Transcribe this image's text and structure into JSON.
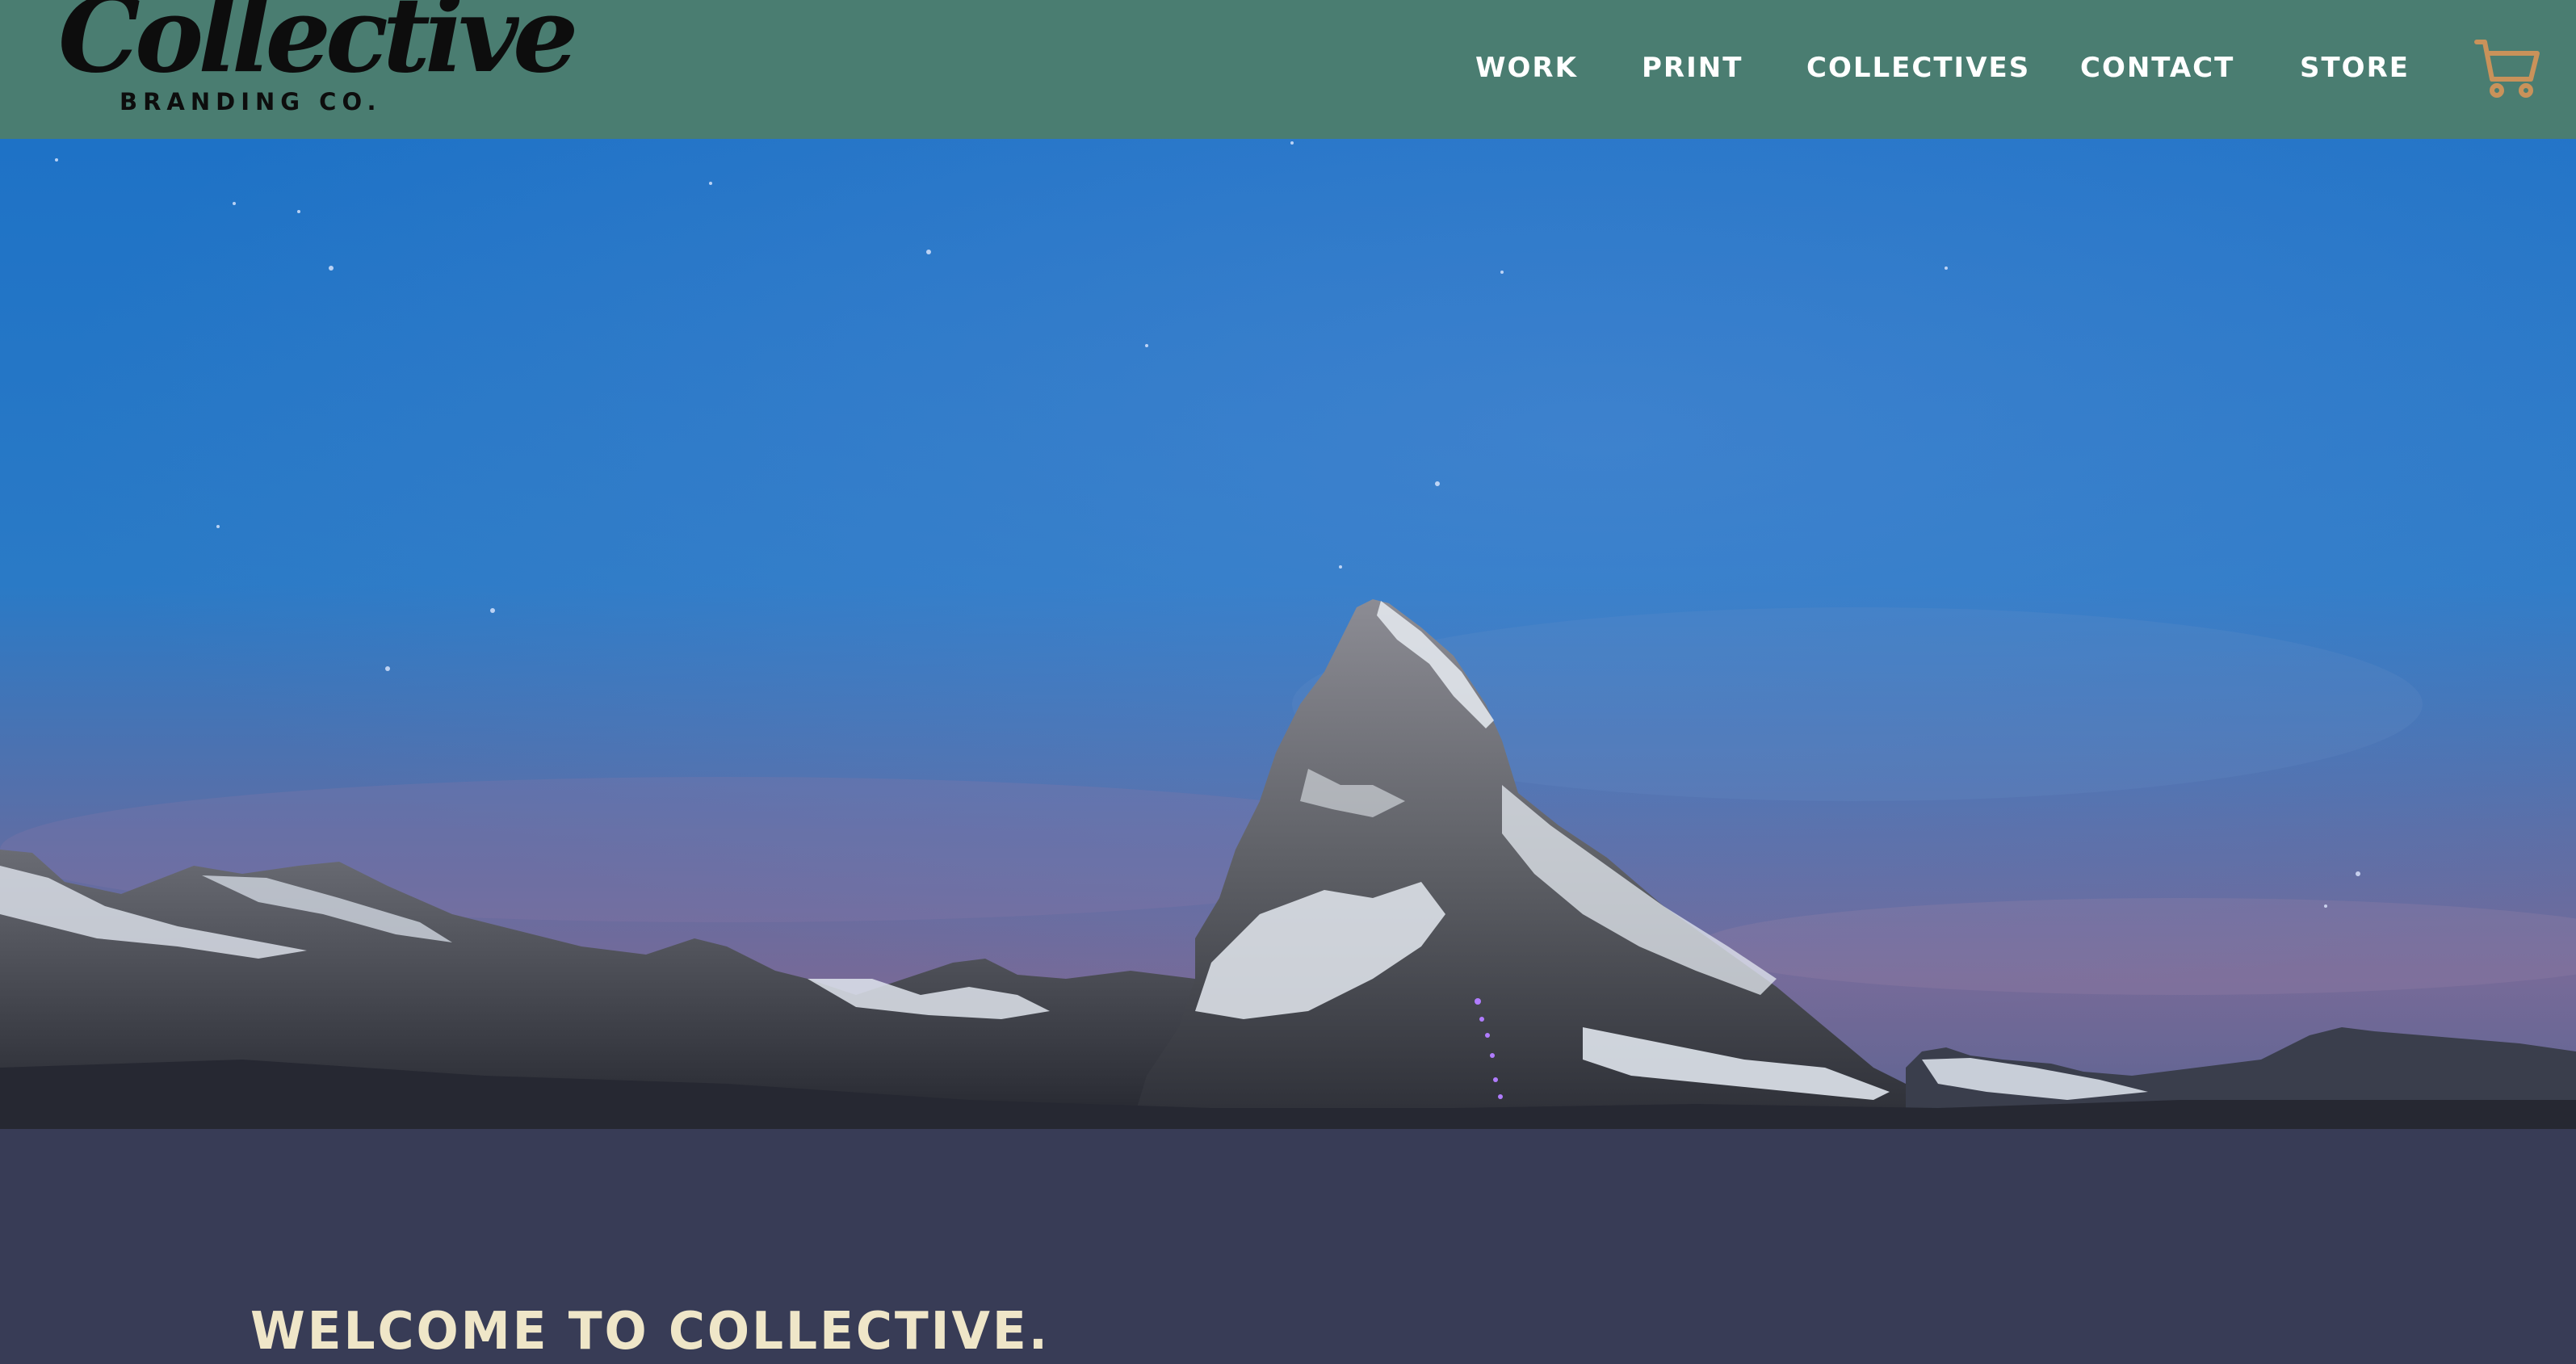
{
  "brand": {
    "name_script": "Collective",
    "subtitle": "BRANDING CO."
  },
  "nav": {
    "items": [
      {
        "label": "WORK"
      },
      {
        "label": "PRINT"
      },
      {
        "label": "COLLECTIVES"
      },
      {
        "label": "CONTACT"
      },
      {
        "label": "STORE"
      }
    ],
    "cart_icon": "shopping-cart-icon"
  },
  "hero": {
    "image": "mountain-peak-night-sky"
  },
  "main": {
    "welcome_heading": "WELCOME TO COLLECTIVE."
  },
  "colors": {
    "header_bg": "#4a7d71",
    "content_bg": "#383c56",
    "heading_color": "#efe6c8",
    "cart_accent": "#c9925a"
  }
}
